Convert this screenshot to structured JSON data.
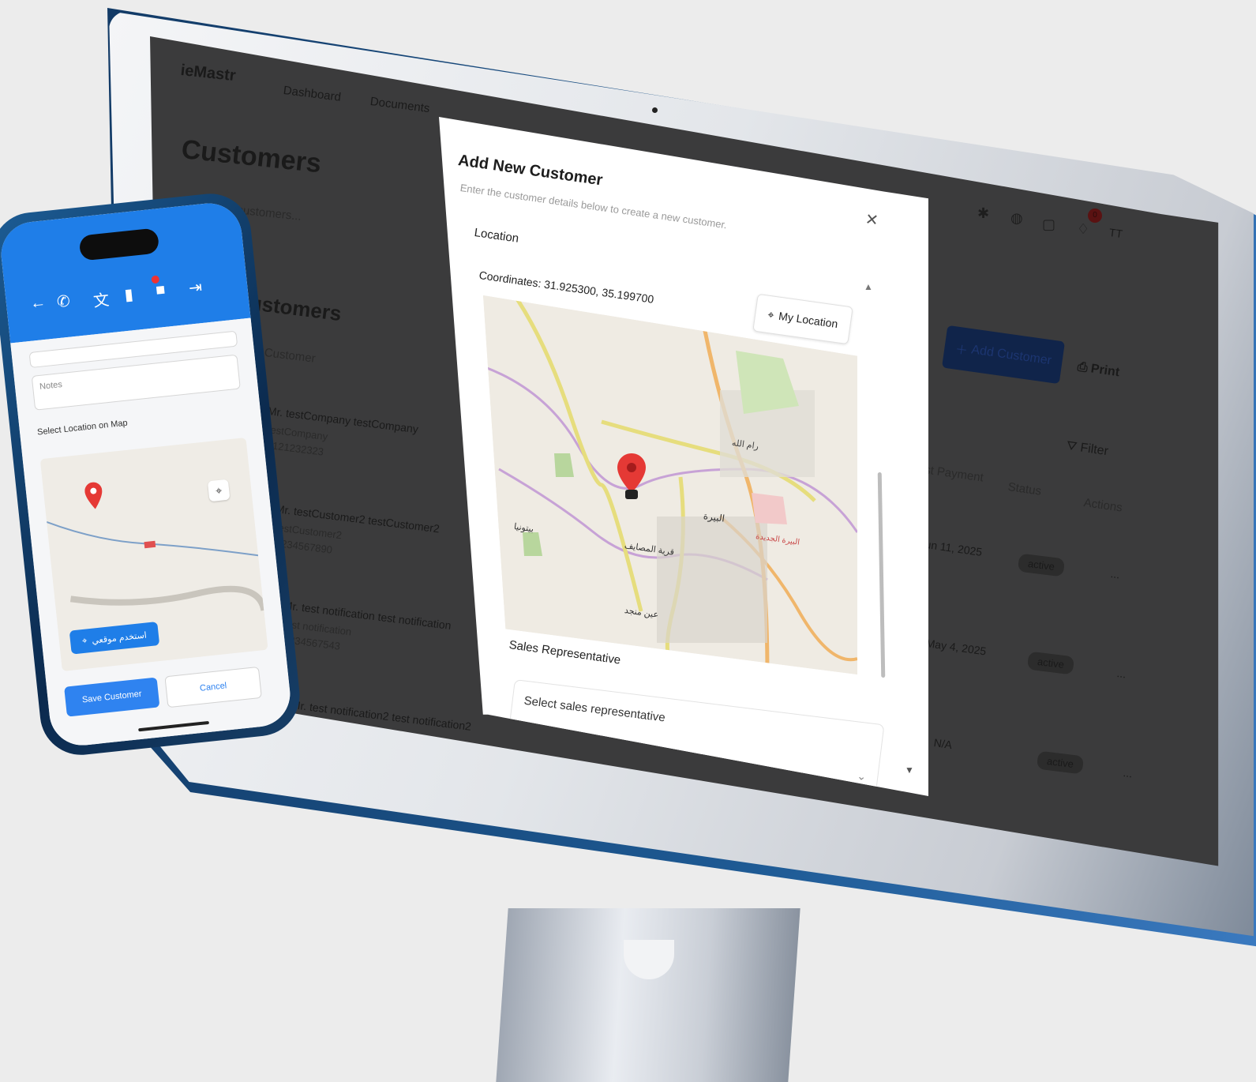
{
  "app": {
    "logo": "ieMastr"
  },
  "nav": {
    "dashboard": "Dashboard",
    "documents": "Documents"
  },
  "page": {
    "title": "Customers",
    "search_placeholder": "Search customers...",
    "section_title": "ustomers",
    "column_customer": "Customer",
    "columns": {
      "last_payment": "Last Payment",
      "status": "Status",
      "actions": "Actions"
    },
    "add_customer": "Add Customer",
    "print": "Print",
    "filter": "Filter",
    "avatar": "TT",
    "notification_count": "0",
    "customers": [
      {
        "name": "Mr. testCompany testCompany",
        "company": "testCompany",
        "phone": "1121232323",
        "last_payment": "Jun 11, 2025",
        "status": "active",
        "actions": "..."
      },
      {
        "name": "Mr. testCustomer2 testCustomer2",
        "company": "testCustomer2",
        "phone": "1234567890",
        "last_payment": "May 4, 2025",
        "status": "active",
        "actions": "..."
      },
      {
        "name": "Mr. test notification test notification",
        "company": "test notification",
        "phone": "1234567543",
        "last_payment": "N/A",
        "status": "active",
        "actions": "..."
      },
      {
        "name": "Mr. test notification2 test notification2"
      }
    ]
  },
  "modal": {
    "title": "Add New Customer",
    "subtitle": "Enter the customer details below to create a new customer.",
    "location_label": "Location",
    "coordinates": "Coordinates: 31.925300, 35.199700",
    "my_location": "My Location",
    "sales_rep_label": "Sales Representative",
    "sales_rep_placeholder": "Select sales representative",
    "map_labels": [
      "رام الله",
      "البيرة",
      "بيتونيا",
      "قرية المصايف",
      "البيرة الجديدة",
      "عين منجد"
    ]
  },
  "phone": {
    "notes_placeholder": "Notes",
    "map_label": "Select Location on Map",
    "map_button": "استخدم موقعي",
    "save": "Save Customer",
    "cancel": "Cancel"
  },
  "colors": {
    "brand_blue": "#1f7ee8",
    "marker_red": "#e53935",
    "screen_dim": "#3b3b3c"
  }
}
